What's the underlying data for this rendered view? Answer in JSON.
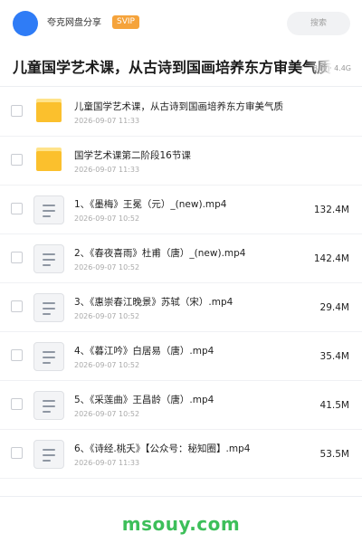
{
  "header": {
    "share_name": "夸克网盘分享",
    "badge": "SVIP",
    "search_placeholder": "搜索"
  },
  "title_bar": {
    "title": "儿童国学艺术课，从古诗到国画培养东方审美气质",
    "meta": "8 项 · 4.4G"
  },
  "items": [
    {
      "type": "folder",
      "name": "儿童国学艺术课，从古诗到国画培养东方审美气质",
      "date": "2026-09-07 11:33",
      "size": ""
    },
    {
      "type": "folder",
      "name": "国学艺术课第二阶段16节课",
      "date": "2026-09-07 11:33",
      "size": ""
    },
    {
      "type": "file",
      "name": "1、《墨梅》王冕（元）_(new).mp4",
      "date": "2026-09-07 10:52",
      "size": "132.4M"
    },
    {
      "type": "file",
      "name": "2、《春夜喜雨》杜甫（唐）_(new).mp4",
      "date": "2026-09-07 10:52",
      "size": "142.4M"
    },
    {
      "type": "file",
      "name": "3、《惠崇春江晚景》苏轼（宋）.mp4",
      "date": "2026-09-07 10:52",
      "size": "29.4M"
    },
    {
      "type": "file",
      "name": "4、《暮江吟》白居易（唐）.mp4",
      "date": "2026-09-07 10:52",
      "size": "35.4M"
    },
    {
      "type": "file",
      "name": "5、《采莲曲》王昌龄（唐）.mp4",
      "date": "2026-09-07 10:52",
      "size": "41.5M"
    },
    {
      "type": "file",
      "name": "6、《诗经.桃夭》【公众号：秘知圈】.mp4",
      "date": "2026-09-07 11:33",
      "size": "53.5M"
    }
  ],
  "footer": {
    "watermark": "msouy.com",
    "watermark_color": "#3dbf5a"
  },
  "colors": {
    "avatar": "#2f7cf6",
    "badge": "#f5a33b",
    "folder": "#fbc02d"
  }
}
